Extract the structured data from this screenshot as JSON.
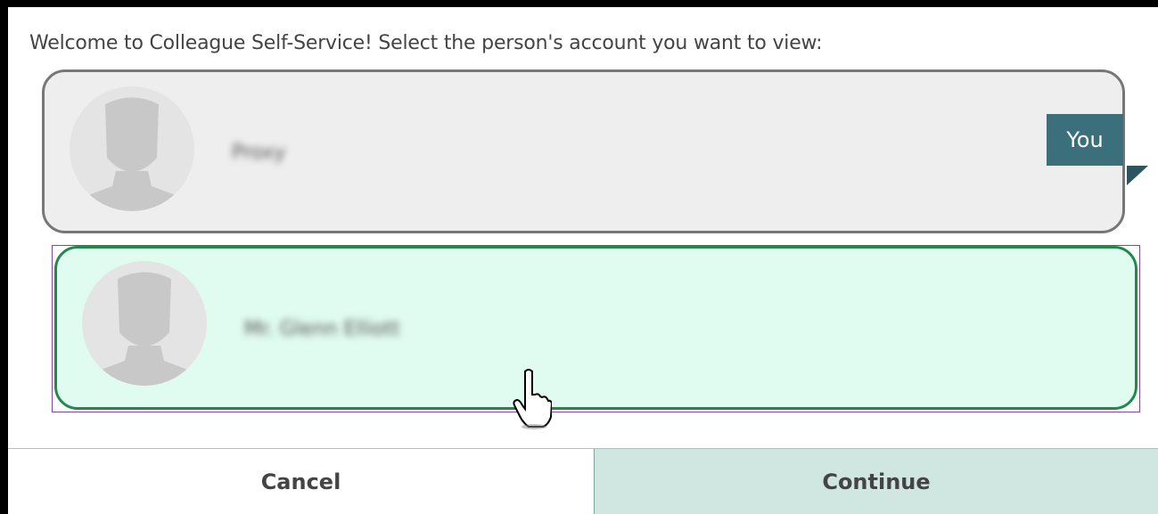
{
  "prompt": "Welcome to Colleague Self-Service! Select the person's account you want to view:",
  "accounts": [
    {
      "name": "Proxy",
      "badge": "You",
      "selected": false
    },
    {
      "name": "Mr. Glenn Elliott",
      "selected": true
    }
  ],
  "buttons": {
    "cancel": "Cancel",
    "continue": "Continue"
  },
  "colors": {
    "selected_border": "#24874f",
    "selected_bg": "#e0fbf0",
    "badge": "#3b6f7c",
    "continue_bg": "#d0e6e1"
  },
  "icons": [
    "person-placeholder-icon",
    "hand-pointer-cursor-icon"
  ]
}
